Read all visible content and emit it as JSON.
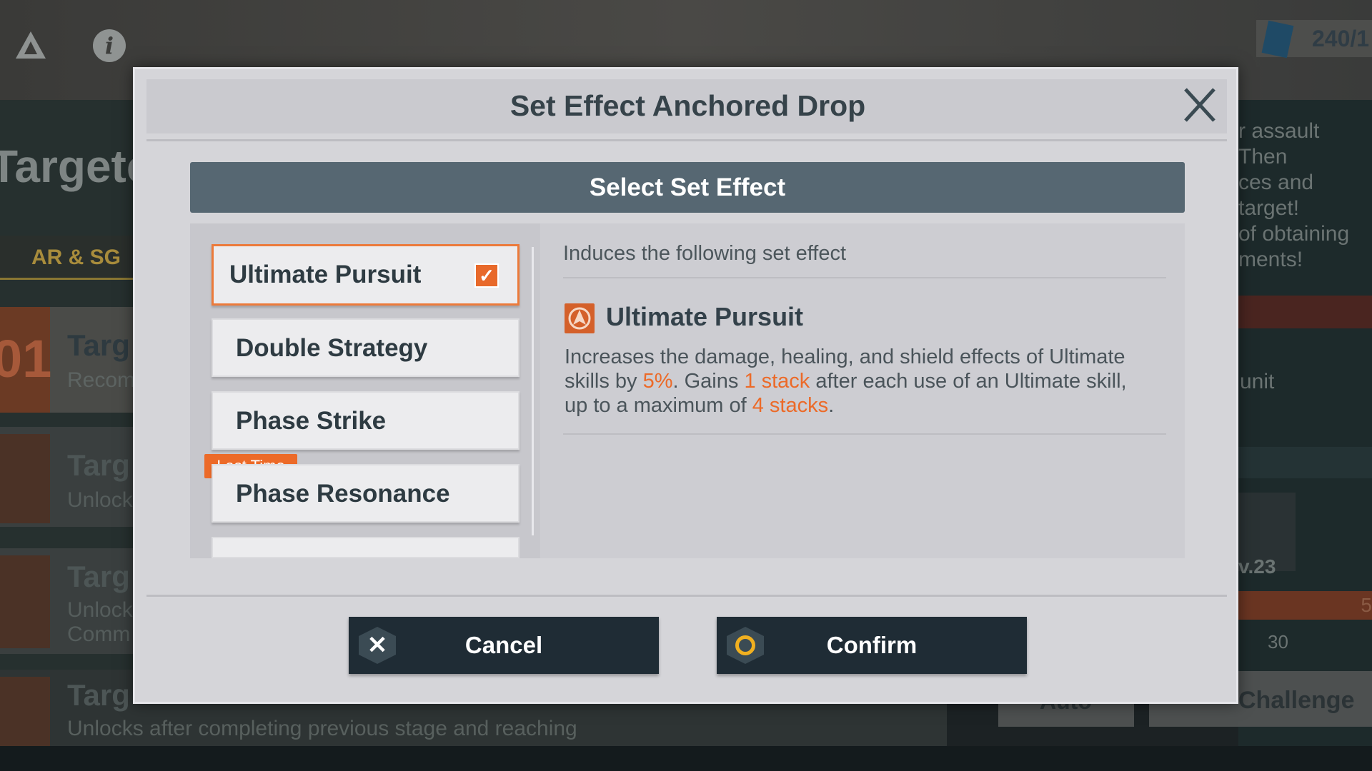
{
  "background": {
    "resource_count": "240/1",
    "page_title": "Targete",
    "tab_label": "AR & SG",
    "card_number": "01",
    "cards": [
      {
        "title": "Targ",
        "subtitle": "Recom"
      },
      {
        "title": "Targ",
        "subtitle": "Unlock"
      },
      {
        "title": "Targ",
        "subtitle": "Unlock",
        "line2": "Comm"
      },
      {
        "title": "Targ",
        "subtitle": "Unlocks after completing previous stage and reaching"
      }
    ],
    "right_text_lines": [
      "r assault",
      "Then",
      "ces and",
      "target!",
      "of obtaining",
      "ments!"
    ],
    "right_unit": "unit",
    "right_level": "v.23",
    "right_count": "30",
    "right_num": "5",
    "auto_label": "Auto",
    "challenge_label": "Challenge"
  },
  "modal": {
    "title": "Set Effect Anchored Drop",
    "section_header": "Select Set Effect",
    "set_effects": [
      {
        "label": "Ultimate Pursuit",
        "selected": true
      },
      {
        "label": "Double Strategy",
        "selected": false
      },
      {
        "label": "Phase Strike",
        "selected": false,
        "tag": "Last Time"
      },
      {
        "label": "Phase Resonance",
        "selected": false
      }
    ],
    "detail": {
      "intro": "Induces the following set effect",
      "name": "Ultimate Pursuit",
      "desc_1": "Increases the damage, healing, and shield effects of Ultimate skills by ",
      "hl_1": "5%",
      "desc_2": ". Gains ",
      "hl_2": "1 stack",
      "desc_3": " after each use of an Ultimate skill, up to a maximum of ",
      "hl_3": "4 stacks",
      "desc_4": "."
    },
    "cancel_label": "Cancel",
    "confirm_label": "Confirm"
  },
  "colors": {
    "accent": "#ec6a28",
    "header": "#566772",
    "button": "#1f2c35"
  }
}
